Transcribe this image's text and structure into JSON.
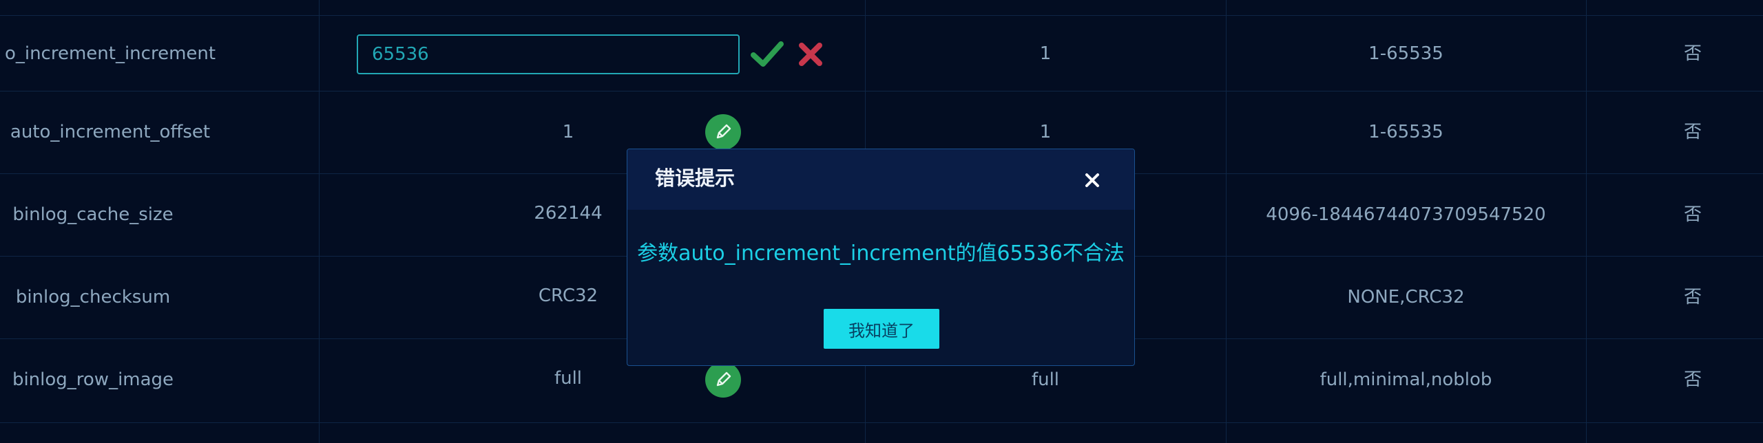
{
  "table": {
    "rows": [
      {
        "name": "o_increment_increment",
        "value": "",
        "default": "1",
        "range": "1-65535",
        "flag": "否"
      },
      {
        "name": "auto_increment_offset",
        "value": "1",
        "default": "1",
        "range": "1-65535",
        "flag": "否"
      },
      {
        "name": "binlog_cache_size",
        "value": "262144",
        "default": "",
        "range": "4096-18446744073709547520",
        "flag": "否"
      },
      {
        "name": "binlog_checksum",
        "value": "CRC32",
        "default": "",
        "range": "NONE,CRC32",
        "flag": "否"
      },
      {
        "name": "binlog_row_image",
        "value": "full",
        "default": "full",
        "range": "full,minimal,noblob",
        "flag": "否"
      }
    ]
  },
  "editor": {
    "current_value": "65536",
    "confirm_icon": "check-icon",
    "cancel_icon": "x-icon"
  },
  "modal": {
    "title": "错误提示",
    "message": "参数auto_increment_increment的值65536不合法",
    "ok_label": "我知道了",
    "close_icon": "close-icon"
  },
  "colors": {
    "background": "#030d22",
    "accent": "#19dbe9",
    "confirm": "#2c9e50",
    "cancel": "#c8374c",
    "text": "#8ea8bf"
  }
}
